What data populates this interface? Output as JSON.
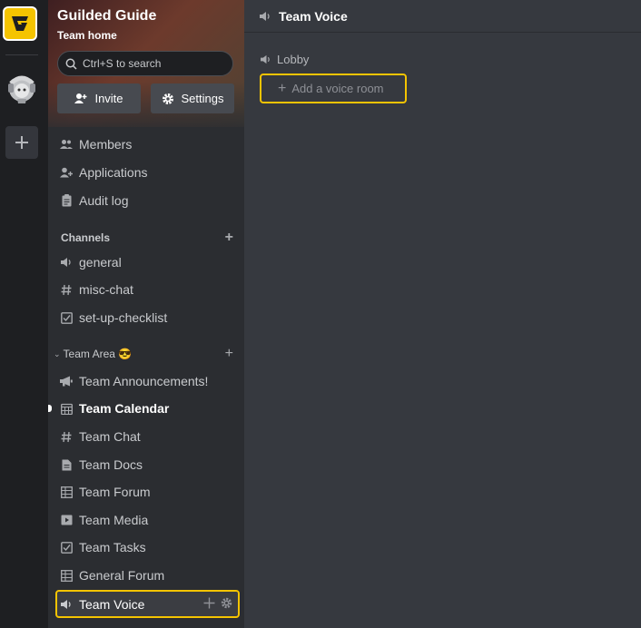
{
  "rail": {
    "add_label": "+"
  },
  "team": {
    "name": "Guilded Guide",
    "subtitle": "Team home",
    "search_placeholder": "Ctrl+S to search",
    "invite_label": "Invite",
    "settings_label": "Settings"
  },
  "nav": {
    "members": "Members",
    "applications": "Applications",
    "audit_log": "Audit log"
  },
  "channels": {
    "heading": "Channels",
    "items": [
      "general",
      "misc-chat",
      "set-up-checklist"
    ]
  },
  "team_area": {
    "heading": "Team Area 😎",
    "items": [
      "Team Announcements!",
      "Team Calendar",
      "Team Chat",
      "Team Docs",
      "Team Forum",
      "Team Media",
      "Team Tasks",
      "General Forum",
      "Team Voice"
    ]
  },
  "main": {
    "title": "Team Voice",
    "lobby": "Lobby",
    "add_room": "Add a voice room"
  },
  "colors": {
    "accent": "#f5c400",
    "sidebar": "#2b2d31",
    "main": "#36393f"
  },
  "icons": {
    "rail": [
      "guilded-logo-icon",
      "team-avatar-icon",
      "plus-icon"
    ],
    "nav": [
      "members-icon",
      "add-user-icon",
      "clipboard-icon"
    ],
    "channels": [
      "speaker-icon",
      "hash-icon",
      "checkbox-icon"
    ],
    "team_area": [
      "megaphone-icon",
      "calendar-icon",
      "hash-icon",
      "document-icon",
      "forum-icon",
      "media-icon",
      "checkbox-icon",
      "forum-icon",
      "speaker-icon"
    ]
  }
}
